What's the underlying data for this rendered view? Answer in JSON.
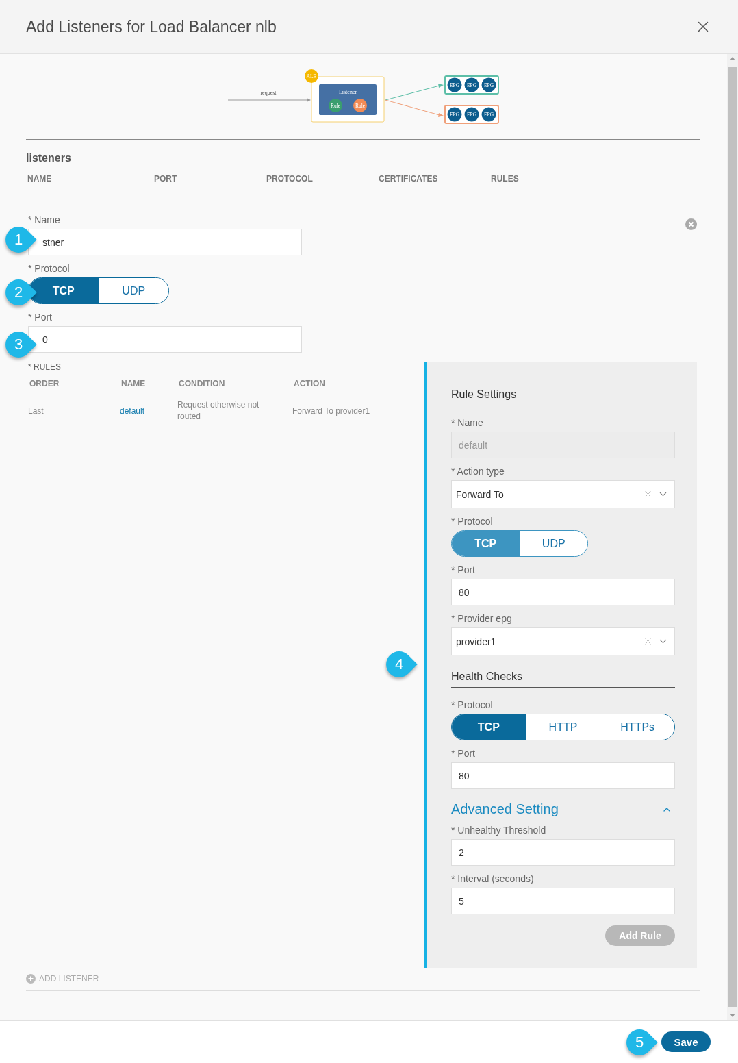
{
  "dialog": {
    "title": "Add Listeners for Load Balancer nlb"
  },
  "diagram": {
    "badge": "ALB",
    "input_label": "request",
    "node": "Listener",
    "rules": [
      {
        "label": "Rule",
        "color": "#3a9e6e"
      },
      {
        "label": "Rule",
        "color": "#f38b55"
      }
    ],
    "targets": [
      {
        "color": "#5dbfa8",
        "epgs": [
          "EPG",
          "EPG",
          "EPG"
        ]
      },
      {
        "color": "#f0a07a",
        "epgs": [
          "EPG",
          "EPG",
          "EPG"
        ]
      }
    ]
  },
  "listeners": {
    "title": "listeners",
    "columns": [
      "NAME",
      "PORT",
      "PROTOCOL",
      "CERTIFICATES",
      "RULES"
    ]
  },
  "listener_form": {
    "name": {
      "label": "* Name",
      "value": "stner"
    },
    "protocol": {
      "label": "* Protocol",
      "options": [
        {
          "label": "TCP",
          "selected": true
        },
        {
          "label": "UDP",
          "selected": false
        }
      ]
    },
    "port": {
      "label": "* Port",
      "value": "0"
    }
  },
  "rules": {
    "label": "* RULES",
    "columns": [
      "ORDER",
      "NAME",
      "CONDITION",
      "ACTION"
    ],
    "rows": [
      {
        "order": "Last",
        "name": "default",
        "condition": "Request otherwise not routed",
        "action": "Forward To provider1"
      }
    ]
  },
  "rule_settings": {
    "title": "Rule Settings",
    "fields": [
      {
        "kind": "input",
        "label": "* Name",
        "value": "default",
        "disabled": true
      },
      {
        "kind": "select",
        "label": "* Action type",
        "value": "Forward To",
        "disabled": false
      },
      {
        "kind": "toggle",
        "label": "* Protocol",
        "disabled": true,
        "options": [
          {
            "label": "TCP",
            "selected": true
          },
          {
            "label": "UDP",
            "selected": false
          }
        ]
      },
      {
        "kind": "input",
        "label": "* Port",
        "value": "80",
        "disabled": false
      },
      {
        "kind": "select",
        "label": "* Provider epg",
        "value": "provider1",
        "disabled": false
      }
    ]
  },
  "health_checks": {
    "title": "Health Checks",
    "fields": [
      {
        "kind": "toggle",
        "label": "* Protocol",
        "disabled": false,
        "options": [
          {
            "label": "TCP",
            "selected": true
          },
          {
            "label": "HTTP",
            "selected": false
          },
          {
            "label": "HTTPs",
            "selected": false
          }
        ]
      },
      {
        "kind": "input",
        "label": "* Port",
        "value": "80",
        "disabled": false
      }
    ]
  },
  "advanced": {
    "title": "Advanced Setting",
    "expanded": true,
    "fields": [
      {
        "kind": "input",
        "label": "* Unhealthy Threshold",
        "value": "2",
        "disabled": false
      },
      {
        "kind": "input",
        "label": "* Interval (seconds)",
        "value": "5",
        "disabled": false
      }
    ]
  },
  "add_rule": {
    "label": "Add Rule",
    "disabled": true
  },
  "add_listener": "ADD LISTENER",
  "save": "Save",
  "callouts": [
    "1",
    "2",
    "3",
    "4",
    "5"
  ]
}
